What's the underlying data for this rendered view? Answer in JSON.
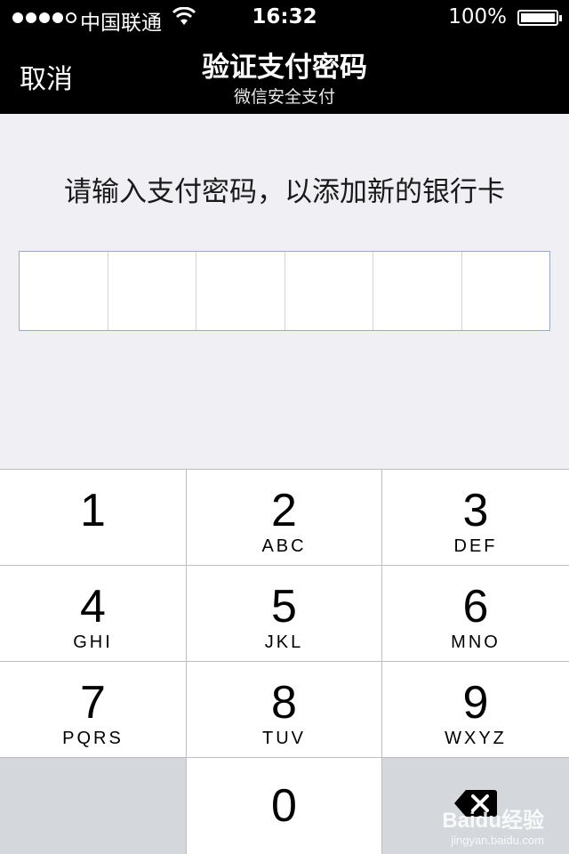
{
  "status_bar": {
    "carrier": "中国联通",
    "time": "16:32",
    "battery": "100%",
    "signal_bars": 4
  },
  "nav": {
    "cancel_label": "取消",
    "title": "验证支付密码",
    "subtitle": "微信安全支付"
  },
  "prompt": "请输入支付密码，以添加新的银行卡",
  "keypad": {
    "keys": [
      {
        "num": "1",
        "letters": ""
      },
      {
        "num": "2",
        "letters": "ABC"
      },
      {
        "num": "3",
        "letters": "DEF"
      },
      {
        "num": "4",
        "letters": "GHI"
      },
      {
        "num": "5",
        "letters": "JKL"
      },
      {
        "num": "6",
        "letters": "MNO"
      },
      {
        "num": "7",
        "letters": "PQRS"
      },
      {
        "num": "8",
        "letters": "TUV"
      },
      {
        "num": "9",
        "letters": "WXYZ"
      },
      {
        "num": "0",
        "letters": ""
      }
    ],
    "delete_icon": "backspace-icon"
  },
  "watermark": {
    "brand": "Baidu经验",
    "url": "jingyan.baidu.com"
  }
}
